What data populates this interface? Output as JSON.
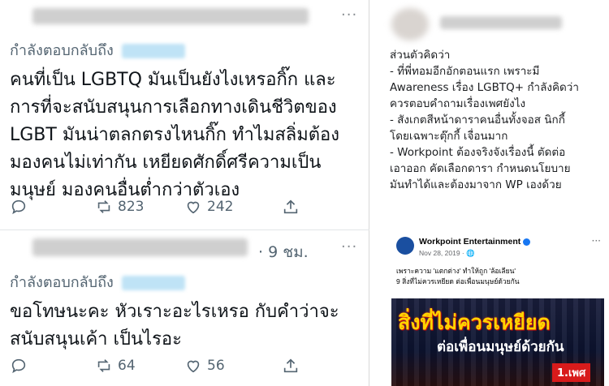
{
  "tweet1": {
    "reply_label": "กำลังตอบกลับถึง",
    "text": "คนที่เป็น LGBTQ มันเป็นยังไงเหรอกิ๊ก และ\nการที่จะสนับสนุนการเลือกทางเดินชีวิตของ\nLGBT มันน่าตลกตรงไหนกิ๊ก ทำไมสลิ่มต้อง\nมองคนไม่เท่ากัน เหยียดศักดิ์ศรีความเป็น\nมนุษย์ มองคนอื่นต่ำกว่าตัวเอง",
    "retweets": "823",
    "likes": "242"
  },
  "tweet2": {
    "time": "· 9 ชม.",
    "reply_label": "กำลังตอบกลับถึง",
    "text": "ขอโทษนะคะ หัวเราะอะไรเหรอ กับคำว่าจะ\nสนับสนุนเค้า เป็นไรอะ",
    "retweets": "64",
    "likes": "56"
  },
  "icons": {
    "more": "more-icon",
    "reply": "reply-icon",
    "retweet": "retweet-icon",
    "like": "heart-icon",
    "share": "share-icon"
  },
  "right_panel": {
    "text": "ส่วนตัวคิดว่า\n- ที่พี่ทอมอีกอักตอนแรก เพราะมี\nAwareness เรื่อง LGBTQ+ กำลังคิดว่า\nควรตอบคำถามเรื่องเพศยังไง\n- สังเกตสีหน้าดาราคนอื่นทั้งจอส นิกกี้\nโดยเฉพาะตุ๊กกี้ เจื่อนมาก\n- Workpoint ต้องจริงจังเรื่องนี้ ตัดต่อ\nเอาออก คัดเลือกดารา กำหนดนโยบาย\nมันทำได้และต้องมาจาก WP เองด้วย",
    "fb_post": {
      "page_name": "Workpoint Entertainment",
      "date": "Nov 28, 2019 · 🌐",
      "caption": "เพราะความ 'แตกต่าง' ทำให้ถูก 'ล้อเลียน'\n9 สิ่งที่ไม่ควรเหยียด ต่อเพื่อนมนุษย์ด้วยกัน",
      "banner_title": "สิ่งที่ไม่ควรเหยียด",
      "banner_subtitle": "ต่อเพื่อนมนุษย์ด้วยกัน",
      "banner_tag": "1.เพศ"
    }
  },
  "colors": {
    "secondary_text": "#536471",
    "banner_title": "#ffd400",
    "banner_tag_bg": "#d81b1b"
  }
}
